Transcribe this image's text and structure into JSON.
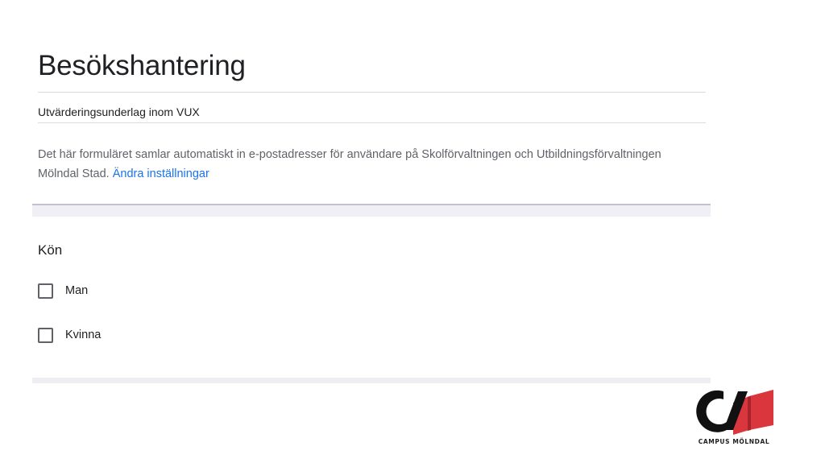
{
  "form": {
    "title": "Besökshantering",
    "subtitle": "Utvärderingsunderlag inom VUX",
    "info_text": "Det här formuläret samlar automatiskt in e-postadresser för användare på Skolförvaltningen och Utbildningsförvaltningen Mölndal Stad. ",
    "info_link": "Ändra inställningar"
  },
  "question": {
    "title": "Kön",
    "options": [
      {
        "label": "Man",
        "checked": false
      },
      {
        "label": "Kvinna",
        "checked": false
      }
    ]
  },
  "logo": {
    "text": "CAMPUS MÖLNDAL",
    "colors": {
      "mark": "#111111",
      "book": "#d9363e",
      "book_shade": "#a8242b"
    }
  }
}
